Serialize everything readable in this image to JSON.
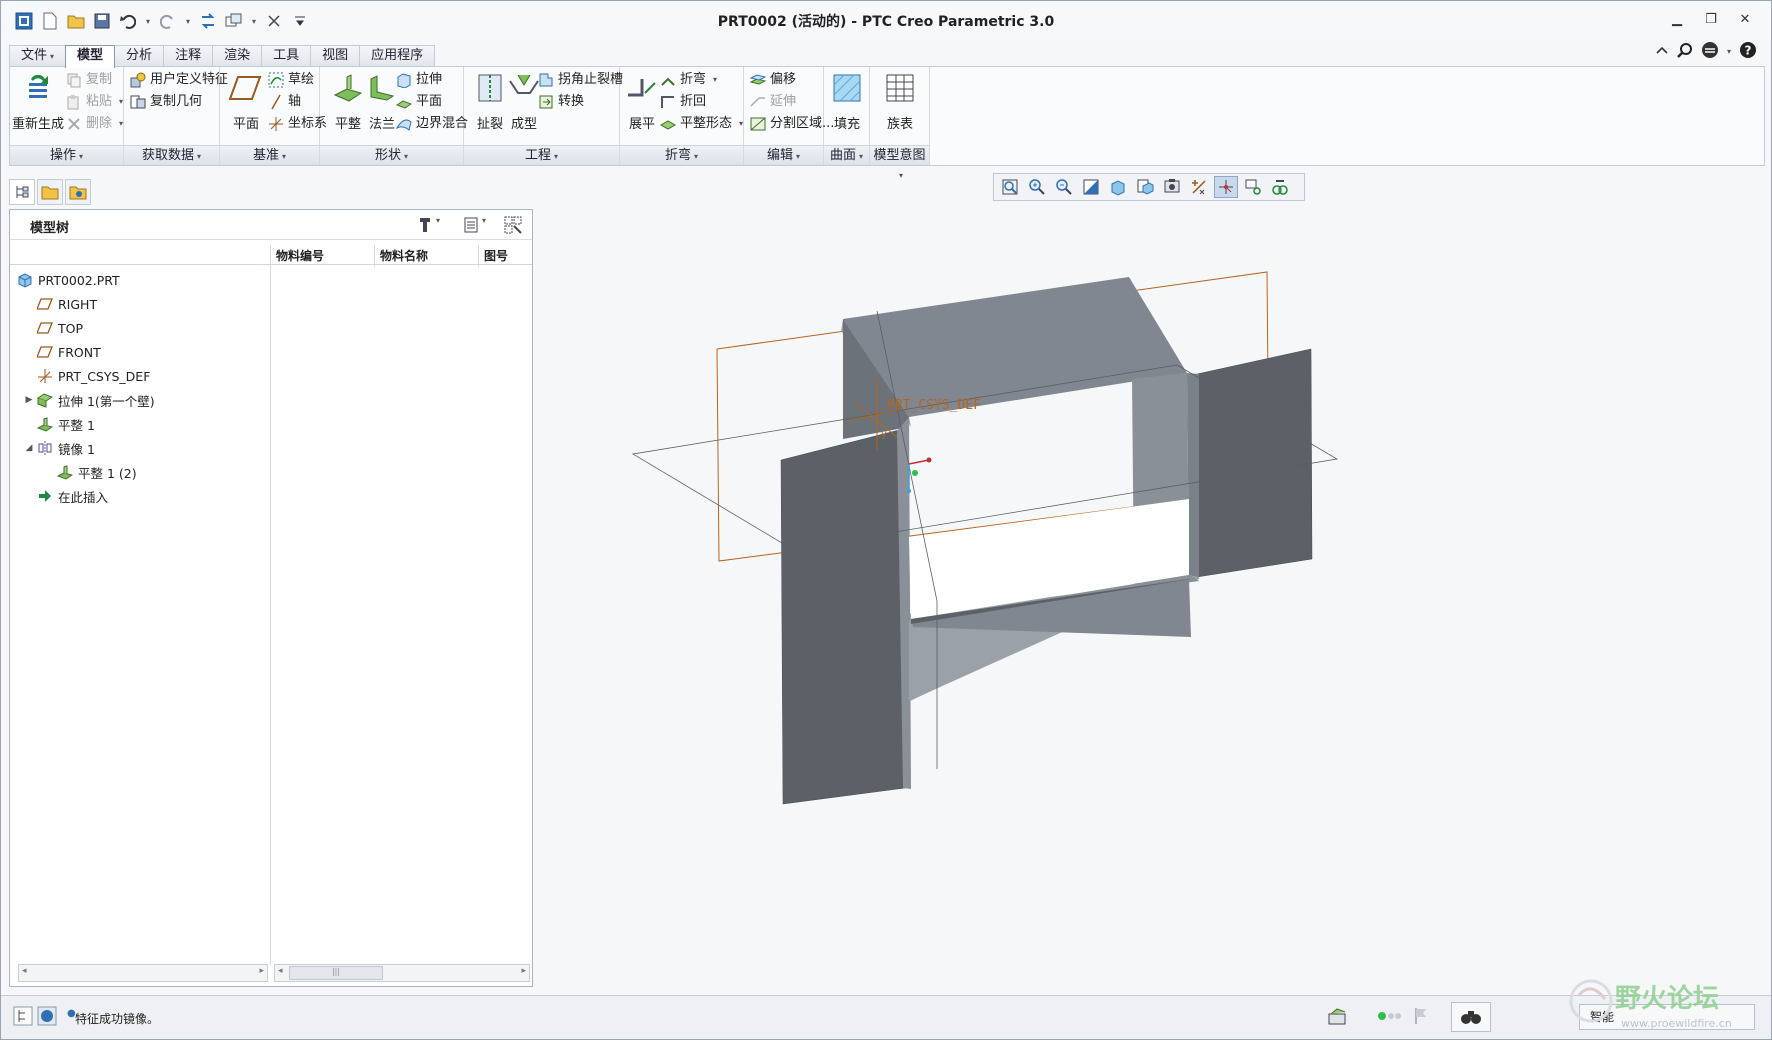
{
  "window": {
    "title": "PRT0002 (活动的) - PTC Creo Parametric 3.0"
  },
  "tabs": [
    {
      "label": "文件",
      "caret": "▾"
    },
    {
      "label": "模型"
    },
    {
      "label": "分析"
    },
    {
      "label": "注释"
    },
    {
      "label": "渲染"
    },
    {
      "label": "工具"
    },
    {
      "label": "视图"
    },
    {
      "label": "应用程序"
    }
  ],
  "ribbon": {
    "ops": {
      "regen": "重新生成",
      "copy": "复制",
      "paste": "粘贴",
      "delete": "删除",
      "footer": "操作"
    },
    "getdata": {
      "udf": "用户定义特征",
      "copygeom": "复制几何",
      "footer": "获取数据"
    },
    "datum": {
      "plane": "平面",
      "sketch": "草绘",
      "axis": "轴",
      "csys": "坐标系",
      "footer": "基准"
    },
    "shapes": {
      "flat": "平整",
      "flange": "法兰",
      "extrude": "拉伸",
      "planar": "平面",
      "blend": "边界混合",
      "footer": "形状"
    },
    "eng": {
      "rip": "扯裂",
      "form": "成型",
      "relief": "拐角止裂槽",
      "convert": "转换",
      "footer": "工程"
    },
    "bends": {
      "unbend": "展平",
      "bend": "折弯",
      "bendback": "折回",
      "flatpattern": "平整形态",
      "footer": "折弯"
    },
    "editing": {
      "offset": "偏移",
      "extend": "延伸",
      "split": "分割区域...",
      "footer": "编辑"
    },
    "surfaces": {
      "fill": "填充",
      "footer": "曲面"
    },
    "intent": {
      "family": "族表",
      "footer": "模型意图"
    }
  },
  "modeltree": {
    "header": "模型树",
    "columns": [
      "物料编号",
      "物料名称",
      "图号"
    ],
    "items": [
      {
        "label": "PRT0002.PRT",
        "icon": "part-icon"
      },
      {
        "label": "RIGHT",
        "icon": "datum-plane-icon"
      },
      {
        "label": "TOP",
        "icon": "datum-plane-icon"
      },
      {
        "label": "FRONT",
        "icon": "datum-plane-icon"
      },
      {
        "label": "PRT_CSYS_DEF",
        "icon": "csys-icon"
      },
      {
        "label": "拉伸 1(第一个壁)",
        "icon": "extrude-wall-icon",
        "toggle": "▶"
      },
      {
        "label": "平整 1",
        "icon": "flat-wall-icon"
      },
      {
        "label": "镜像 1",
        "icon": "mirror-icon",
        "toggle": "◢"
      },
      {
        "label": "平整 1 (2)",
        "icon": "flat-wall-icon"
      },
      {
        "label": "在此插入",
        "icon": "insert-here-icon"
      }
    ]
  },
  "viewport": {
    "csys_label": "PRT_CSYS_DEF"
  },
  "statusbar": {
    "message": "特征成功镜像。",
    "filter": "智能"
  },
  "watermark": {
    "text": "野火论坛",
    "url": "www.proewildfire.cn"
  },
  "colors": {
    "accent": "#2f6fb3",
    "part_face": "#7d838c",
    "part_dark": "#585d64",
    "datum": "#b5651d"
  }
}
